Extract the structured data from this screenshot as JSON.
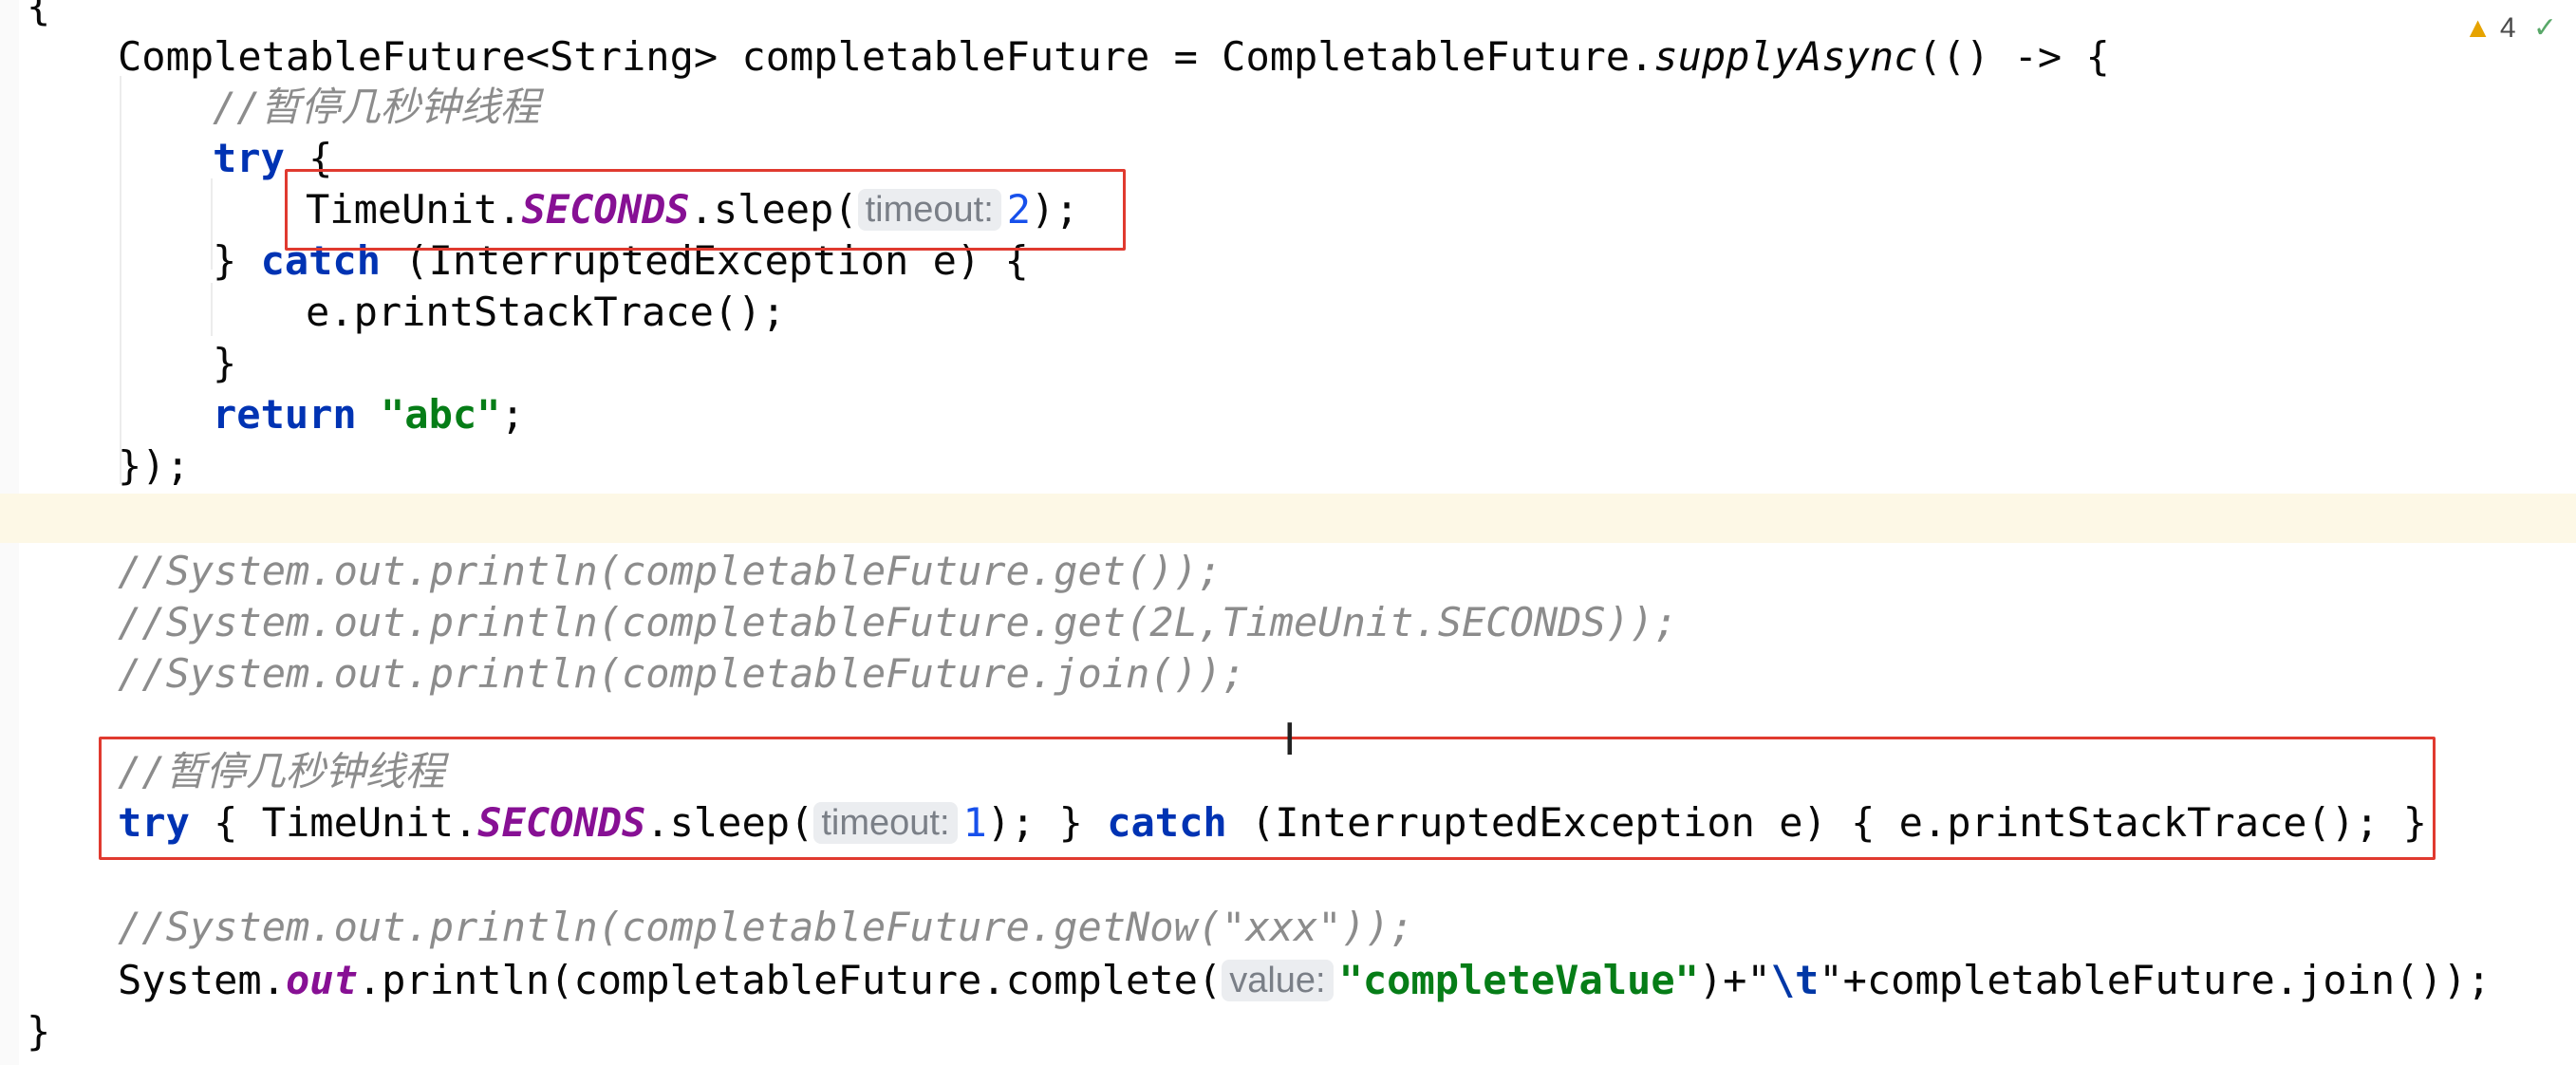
{
  "status": {
    "warning_count": "4"
  },
  "code": {
    "l0_brace": "{",
    "l1": {
      "type": "CompletableFuture<String> completableFuture = CompletableFuture.",
      "method": "supplyAsync",
      "tail": "(() -> {"
    },
    "l2_comment": "//暂停几秒钟线程",
    "l3": {
      "kw": "try",
      "tail": " {"
    },
    "l4": {
      "pre": "TimeUnit.",
      "const": "SECONDS",
      "call": ".sleep(",
      "hint": "timeout:",
      "num": "2",
      "end": ");"
    },
    "l5": {
      "pre": "} ",
      "kw": "catch",
      "tail": " (InterruptedException e) {"
    },
    "l6": "e.printStackTrace();",
    "l7": "}",
    "l8": {
      "kw": "return",
      "str": "\"abc\"",
      "end": ";"
    },
    "l9": "});",
    "c1": "//System.out.println(completableFuture.get());",
    "c2": "//System.out.println(completableFuture.get(2L,TimeUnit.SECONDS));",
    "c3": "//System.out.println(completableFuture.join());",
    "c4": "//暂停几秒钟线程",
    "l10": {
      "kw1": "try",
      "a": " { TimeUnit.",
      "const": "SECONDS",
      "b": ".sleep(",
      "hint": "timeout:",
      "num": "1",
      "c": "); } ",
      "kw2": "catch",
      "d": " (InterruptedException e) { e.printStackTrace(); }"
    },
    "c5": "//System.out.println(completableFuture.getNow(\"xxx\"));",
    "l11": {
      "pre": "System.",
      "static": "out",
      "call": ".println(completableFuture.complete(",
      "hint": "value:",
      "str": "\"completeValue\"",
      "mid": ")+\"",
      "esc": "\\t",
      "end": "\"+completableFuture.join());"
    },
    "l12_brace": "}"
  }
}
